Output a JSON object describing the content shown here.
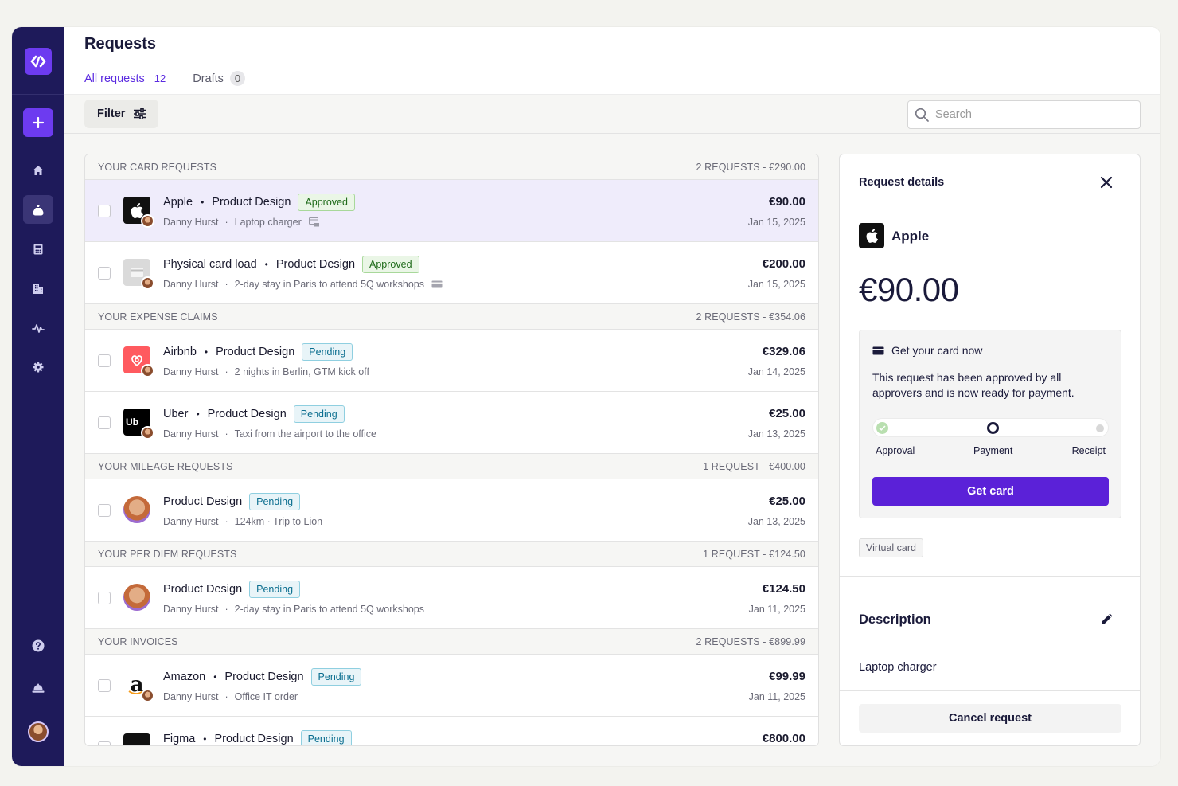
{
  "header": {
    "title": "Requests"
  },
  "tabs": [
    {
      "label": "All requests",
      "count": "12"
    },
    {
      "label": "Drafts",
      "count": "0"
    }
  ],
  "toolbar": {
    "filter_label": "Filter",
    "search_placeholder": "Search"
  },
  "groups": [
    {
      "title": "YOUR CARD REQUESTS",
      "summary": "2 REQUESTS - €290.00"
    },
    {
      "title": "YOUR EXPENSE CLAIMS",
      "summary": "2 REQUESTS - €354.06"
    },
    {
      "title": "YOUR MILEAGE REQUESTS",
      "summary": "1 REQUEST - €400.00"
    },
    {
      "title": "YOUR PER DIEM REQUESTS",
      "summary": "1 REQUEST - €124.50"
    },
    {
      "title": "YOUR INVOICES",
      "summary": "2 REQUESTS - €899.99"
    }
  ],
  "rows": [
    {
      "merchant": "Apple",
      "category": "Product Design",
      "status": "Approved",
      "requester": "Danny Hurst",
      "note": "Laptop charger",
      "amount": "€90.00",
      "date": "Jan 15, 2025"
    },
    {
      "merchant": "Physical card load",
      "category": "Product Design",
      "status": "Approved",
      "requester": "Danny Hurst",
      "note": "2-day stay in Paris to attend 5Q workshops",
      "amount": "€200.00",
      "date": "Jan 15, 2025"
    },
    {
      "merchant": "Airbnb",
      "category": "Product Design",
      "status": "Pending",
      "requester": "Danny Hurst",
      "note": "2 nights in Berlin, GTM kick off",
      "amount": "€329.06",
      "date": "Jan 14, 2025"
    },
    {
      "merchant": "Uber",
      "category": "Product Design",
      "status": "Pending",
      "requester": "Danny Hurst",
      "note": "Taxi from the airport to the office",
      "amount": "€25.00",
      "date": "Jan 13, 2025"
    },
    {
      "merchant": "",
      "category": "Product Design",
      "status": "Pending",
      "requester": "Danny Hurst",
      "note": "124km · Trip to Lion",
      "amount": "€25.00",
      "date": "Jan 13, 2025"
    },
    {
      "merchant": "",
      "category": "Product Design",
      "status": "Pending",
      "requester": "Danny Hurst",
      "note": "2-day stay in Paris to attend 5Q workshops",
      "amount": "€124.50",
      "date": "Jan 11, 2025"
    },
    {
      "merchant": "Amazon",
      "category": "Product Design",
      "status": "Pending",
      "requester": "Danny Hurst",
      "note": "Office IT order",
      "amount": "€99.99",
      "date": "Jan 11, 2025"
    },
    {
      "merchant": "Figma",
      "category": "Product Design",
      "status": "Pending",
      "requester": "",
      "note": "",
      "amount": "€800.00",
      "date": ""
    }
  ],
  "details": {
    "title": "Request details",
    "merchant": "Apple",
    "amount": "€90.00",
    "card_heading": "Get your card now",
    "card_text": "This request has been approved by all approvers and is now ready for payment.",
    "steps": [
      "Approval",
      "Payment",
      "Receipt"
    ],
    "get_card_label": "Get card",
    "virtual_card_tag": "Virtual card",
    "description_title": "Description",
    "description": "Laptop charger",
    "cancel_label": "Cancel request"
  },
  "colors": {
    "sidebar": "#1e1a5a",
    "accent": "#5b21d8",
    "approved": "#1f6b1a",
    "pending": "#0b6e8f"
  },
  "icons": [
    "logo-icon",
    "plus-icon",
    "home-icon",
    "money-bag-icon",
    "calculator-icon",
    "building-icon",
    "activity-icon",
    "settings-icon",
    "help-icon",
    "bell-icon"
  ]
}
